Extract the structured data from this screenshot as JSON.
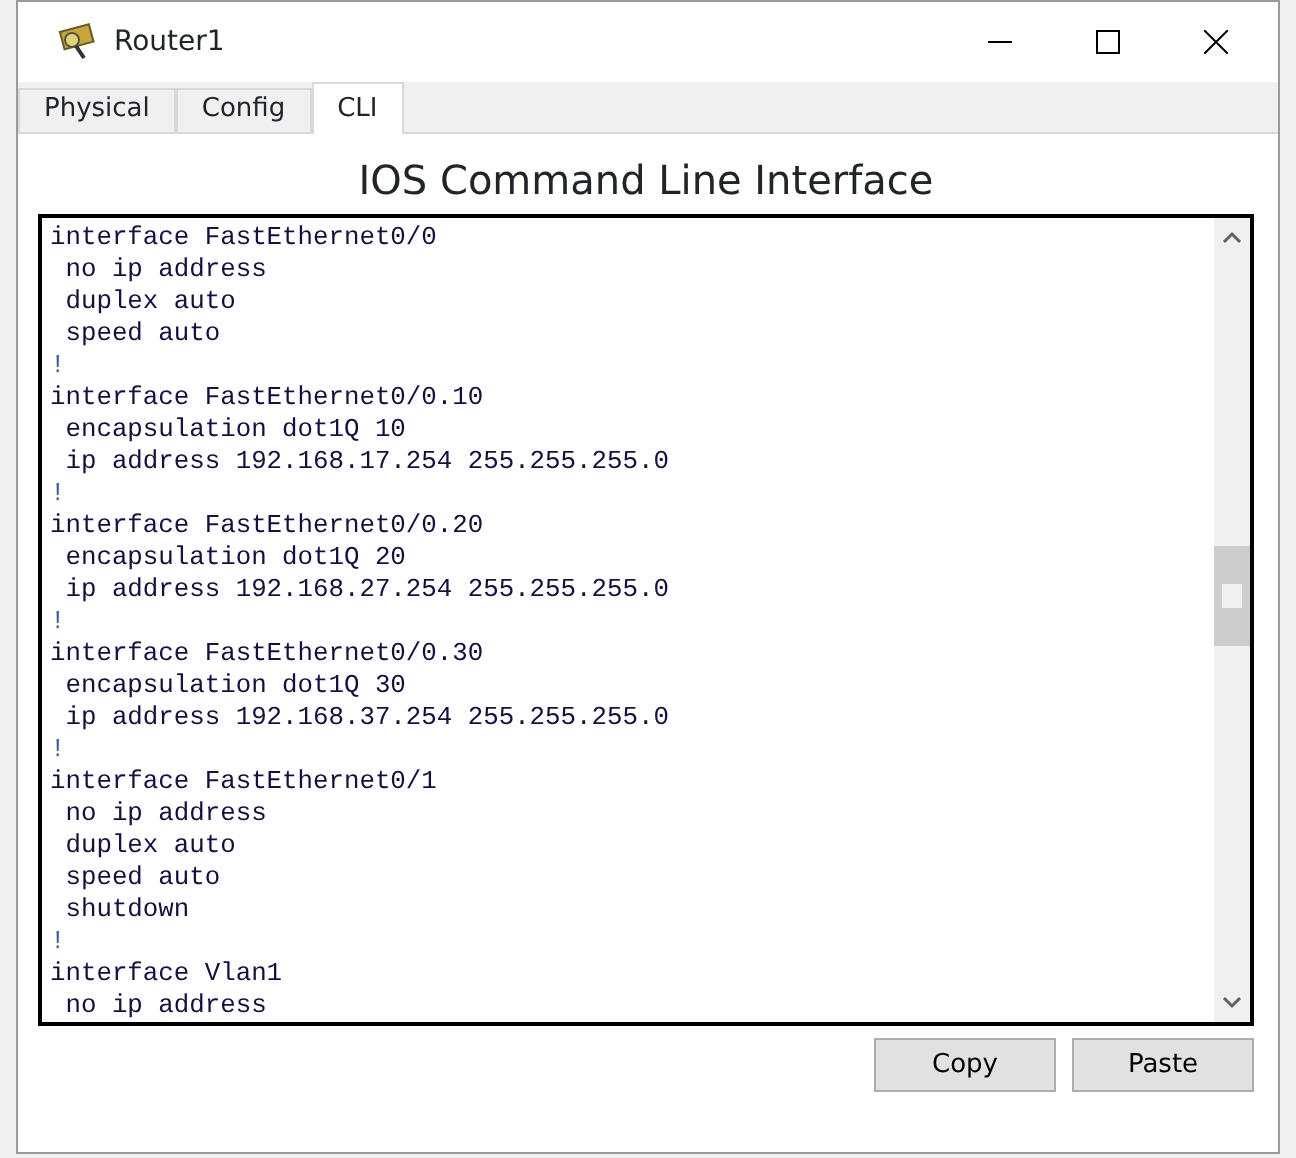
{
  "window": {
    "title": "Router1"
  },
  "tabs": [
    {
      "label": "Physical",
      "selected": false
    },
    {
      "label": "Config",
      "selected": false
    },
    {
      "label": "CLI",
      "selected": true
    }
  ],
  "heading": "IOS Command Line Interface",
  "console": {
    "lines": [
      "interface FastEthernet0/0",
      " no ip address",
      " duplex auto",
      " speed auto",
      "!",
      "interface FastEthernet0/0.10",
      " encapsulation dot1Q 10",
      " ip address 192.168.17.254 255.255.255.0",
      "!",
      "interface FastEthernet0/0.20",
      " encapsulation dot1Q 20",
      " ip address 192.168.27.254 255.255.255.0",
      "!",
      "interface FastEthernet0/0.30",
      " encapsulation dot1Q 30",
      " ip address 192.168.37.254 255.255.255.0",
      "!",
      "interface FastEthernet0/1",
      " no ip address",
      " duplex auto",
      " speed auto",
      " shutdown",
      "!",
      "interface Vlan1",
      " no ip address"
    ]
  },
  "buttons": [
    "Copy",
    "Paste"
  ]
}
